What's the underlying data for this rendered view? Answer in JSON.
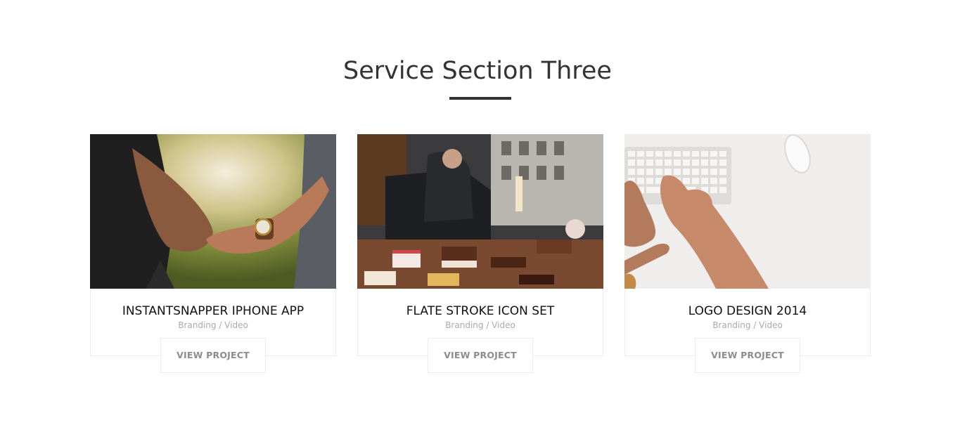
{
  "section": {
    "title": "Service Section Three"
  },
  "cards": [
    {
      "title": "INSTANTSNAPPER IPHONE APP",
      "subtitle": "Branding / Video",
      "button": "VIEW PROJECT",
      "image": "holding-hands-photo"
    },
    {
      "title": "FLATE STROKE ICON SET",
      "subtitle": "Branding / Video",
      "button": "VIEW PROJECT",
      "image": "bakery-window-photo"
    },
    {
      "title": "LOGO DESIGN 2014",
      "subtitle": "Branding / Video",
      "button": "VIEW PROJECT",
      "image": "keyboard-typing-photo"
    }
  ],
  "colors": {
    "title": "#333333",
    "card_title": "#111111",
    "subtitle": "#aaaaaa",
    "button_text": "#8c8c8c",
    "border": "#ececec"
  }
}
